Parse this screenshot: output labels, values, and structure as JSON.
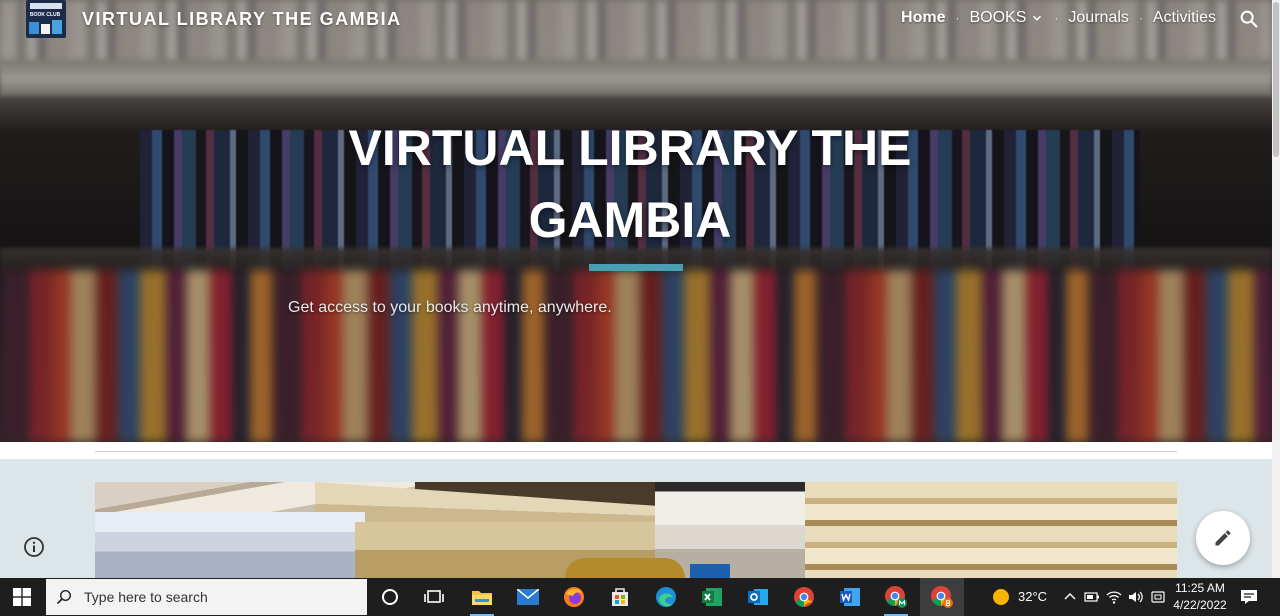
{
  "site": {
    "title": "VIRTUAL LIBRARY THE GAMBIA",
    "logo_text": "BOOK CLUB"
  },
  "nav": {
    "items": [
      {
        "label": "Home",
        "active": true
      },
      {
        "label": "BOOKS",
        "has_dropdown": true
      },
      {
        "label": "Journals"
      },
      {
        "label": "Activities"
      }
    ],
    "separator": "·",
    "search_icon": "search-icon"
  },
  "hero": {
    "title_line1": "VIRTUAL LIBRARY  THE",
    "title_line2": "GAMBIA",
    "subtitle": "Get access to your books anytime, anywhere.",
    "accent_color": "#4a9fb5"
  },
  "content": {
    "background_color": "#dce5e8",
    "image": "stacked-books-photo"
  },
  "fab": {
    "edit_icon": "pencil-icon",
    "info_icon": "info-icon"
  },
  "taskbar": {
    "search_placeholder": "Type here to search",
    "weather_temp": "32°C",
    "time": "11:25 AM",
    "date": "4/22/2022",
    "pinned": [
      "cortana-icon",
      "task-view-icon",
      "file-explorer-icon",
      "mail-icon",
      "firefox-icon",
      "store-icon",
      "edge-icon",
      "excel-icon",
      "outlook-icon",
      "chrome-icon",
      "word-icon",
      "chrome-profile-m-icon",
      "chrome-profile-b-icon"
    ]
  },
  "colors": {
    "accent": "#4a9fb5",
    "taskbar": "#1e1e1e",
    "content_bg": "#dce5e8"
  }
}
